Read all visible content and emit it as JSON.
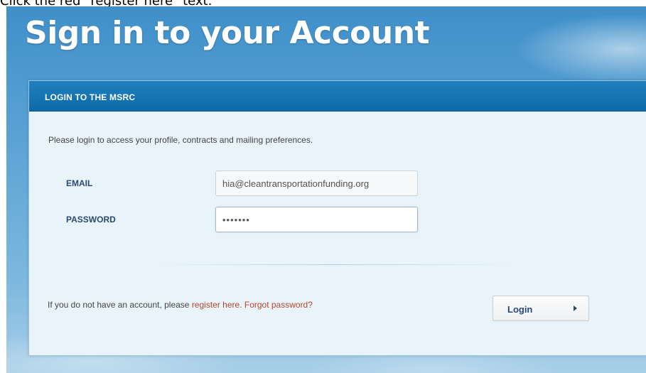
{
  "instruction": "Click the red \"register here\" text.",
  "page": {
    "title": "Sign in to your Account"
  },
  "panel": {
    "header": "LOGIN TO THE MSRC",
    "intro": "Please login to access your profile, contracts and mailing preferences."
  },
  "form": {
    "email_label": "EMAIL",
    "email_value": "hia@cleantransportationfunding.org",
    "password_label": "PASSWORD",
    "password_value": "•••••••"
  },
  "footer": {
    "prefix": "If you do not have an account, please ",
    "register_link": "register here.",
    "forgot_link": "Forgot password?"
  },
  "login_button": {
    "label": "Login",
    "icon": "play-arrow-icon"
  },
  "colors": {
    "link": "#b5452a",
    "header_bg": "#1573b4",
    "label": "#2a4a73"
  }
}
